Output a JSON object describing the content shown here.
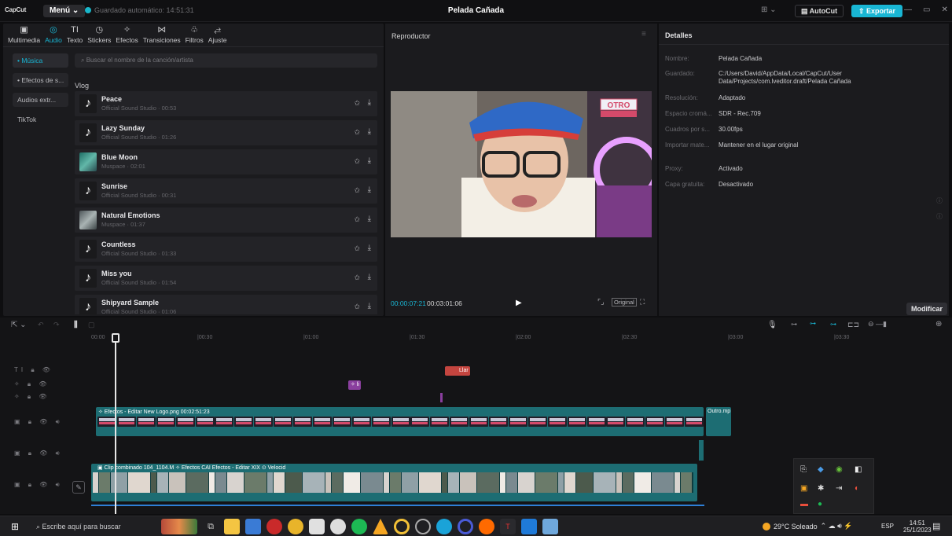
{
  "app": {
    "logo": "CapCut",
    "menu_label": "Menú",
    "autosave": "Guardado automático: 14:51:31",
    "project_title": "Pelada Cañada",
    "autocut_label": "AutoCut",
    "export_label": "Exportar"
  },
  "media_tabs": [
    {
      "label": "Multimedia",
      "icon": "media-icon",
      "glyph": "▣"
    },
    {
      "label": "Audio",
      "icon": "audio-icon",
      "glyph": "◎"
    },
    {
      "label": "Texto",
      "icon": "text-icon",
      "glyph": "TI"
    },
    {
      "label": "Stickers",
      "icon": "sticker-icon",
      "glyph": "◷"
    },
    {
      "label": "Efectos",
      "icon": "effects-icon",
      "glyph": "✧"
    },
    {
      "label": "Transiciones",
      "icon": "transitions-icon",
      "glyph": "⋈"
    },
    {
      "label": "Filtros",
      "icon": "filters-icon",
      "glyph": "♧"
    },
    {
      "label": "Ajuste",
      "icon": "adjust-icon",
      "glyph": "⥄"
    }
  ],
  "sidebar": [
    {
      "label": "• Música",
      "active": true
    },
    {
      "label": "• Efectos de s...",
      "active": false
    },
    {
      "label": "Audios extr...",
      "active": false
    },
    {
      "label": "TikTok",
      "active": false
    }
  ],
  "search": {
    "placeholder": "Buscar el nombre de la canción/artista"
  },
  "section_title": "Vlog",
  "songs": [
    {
      "title": "Peace",
      "sub": "Official Sound Studio · 00:53",
      "thumb": "tiktok"
    },
    {
      "title": "Lazy Sunday",
      "sub": "Official Sound Studio · 01:26",
      "thumb": "tiktok"
    },
    {
      "title": "Blue Moon",
      "sub": "Muspace · 02:01",
      "thumb": "image"
    },
    {
      "title": "Sunrise",
      "sub": "Official Sound Studio · 00:31",
      "thumb": "tiktok"
    },
    {
      "title": "Natural Emotions",
      "sub": "Muspace · 01:37",
      "thumb": "image2"
    },
    {
      "title": "Countless",
      "sub": "Official Sound Studio · 01:33",
      "thumb": "tiktok"
    },
    {
      "title": "Miss you",
      "sub": "Official Sound Studio · 01:54",
      "thumb": "tiktok"
    },
    {
      "title": "Shipyard Sample",
      "sub": "Official Sound Studio · 01:06",
      "thumb": "tiktok"
    }
  ],
  "player": {
    "title": "Reproductor",
    "time_current": "00:00:07:21",
    "time_total": "00:03:01:06",
    "original_label": "Original",
    "overlay_logo": "OTRO"
  },
  "details": {
    "title": "Detalles",
    "rows": [
      {
        "key": "Nombre:",
        "value": "Pelada Cañada"
      },
      {
        "key": "Guardado:",
        "value": "C:/Users/David/AppData/Local/CapCut/User Data/Projects/com.lveditor.draft/Pelada Cañada"
      },
      {
        "key": "Resolución:",
        "value": "Adaptado"
      },
      {
        "key": "Espacio cromá...",
        "value": "SDR - Rec.709"
      },
      {
        "key": "Cuadros por s...",
        "value": "30.00fps"
      },
      {
        "key": "Importar mate...",
        "value": "Mantener en el lugar original"
      },
      {
        "key": "Proxy:",
        "value": "Activado"
      },
      {
        "key": "Capa gratuita:",
        "value": "Desactivado"
      }
    ],
    "modify_label": "Modificar"
  },
  "timeline": {
    "ruler": [
      "00:00",
      "|00:30",
      "|01:00",
      "|01:30",
      "|02:00",
      "|02:30",
      "|03:00",
      "|03:30"
    ],
    "text_clip": "Llar",
    "effect_clip": "✧ li",
    "overlay_label": "✧ Efectos - Editar   New Logo.png   00:02:51:23",
    "outro_label": "Outro.mp",
    "main_label": "▣ Clip combinado  104_1104.M   ✧ Efectos   CAI   Efectos - Editar   XIX   ⊙ Velocid"
  },
  "taskbar": {
    "search_placeholder": "Escribe aquí para buscar",
    "weather": "29°C Soleado",
    "lang": "ESP",
    "time": "14:51",
    "date": "25/1/2023"
  },
  "colors": {
    "accent": "#19b6d4",
    "clip_teal": "#1d6d73",
    "text_clip": "#c4453f",
    "effect_clip": "#8a3f9e"
  }
}
